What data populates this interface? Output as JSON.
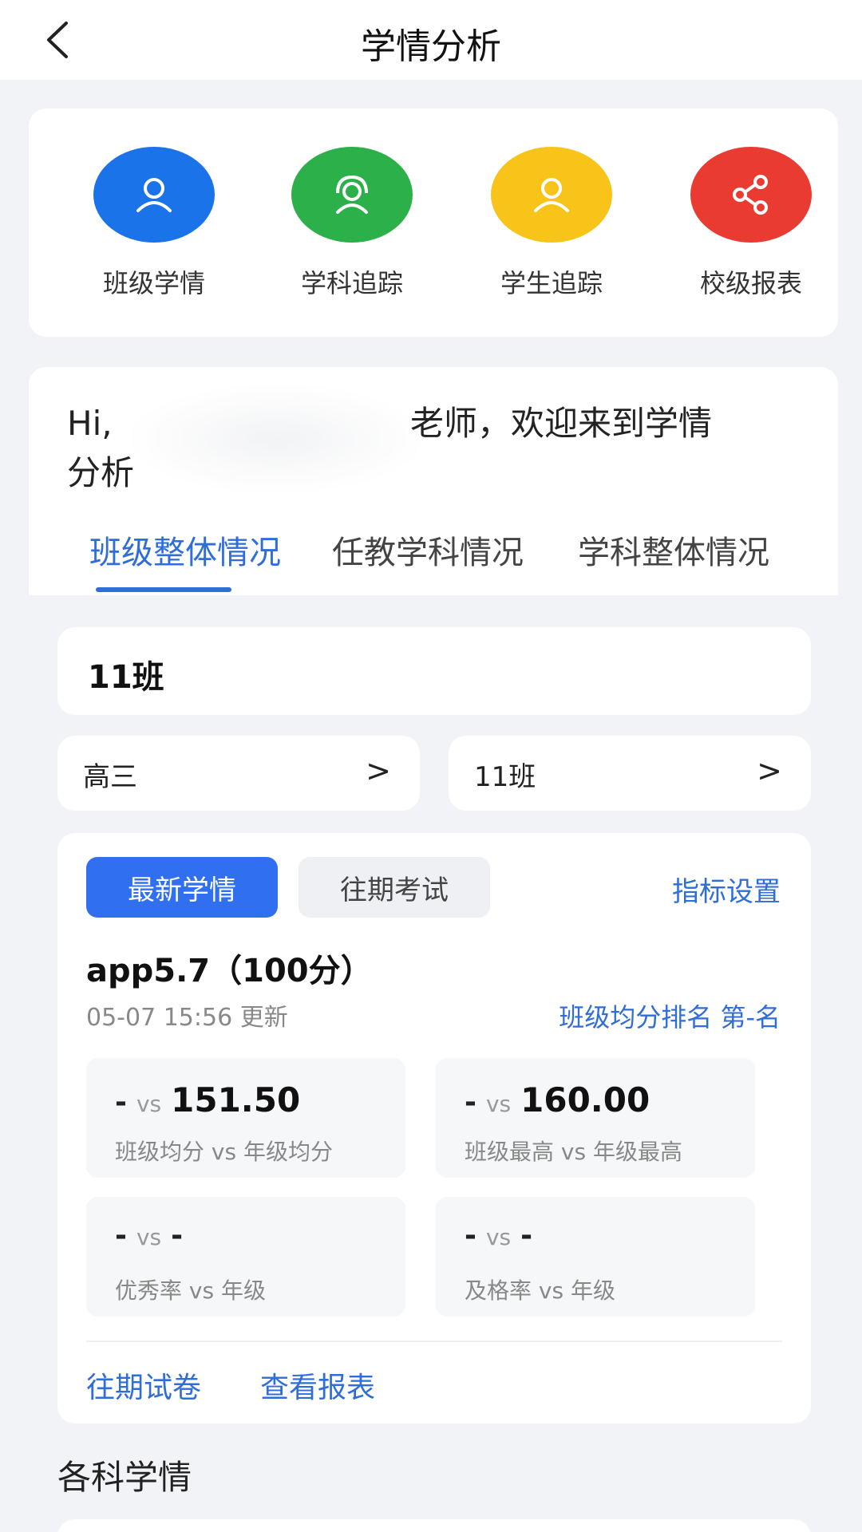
{
  "header": {
    "title": "学情分析"
  },
  "quick_actions": [
    {
      "label": "班级学情",
      "icon": "user-icon",
      "color": "#1a73e8"
    },
    {
      "label": "学科追踪",
      "icon": "headset-user-icon",
      "color": "#2bb04a"
    },
    {
      "label": "学生追踪",
      "icon": "user-icon",
      "color": "#f8c41a"
    },
    {
      "label": "校级报表",
      "icon": "share-icon",
      "color": "#ea3b32"
    }
  ],
  "welcome": {
    "hi": "Hi,",
    "line1_rest": "老师，欢迎来到学情",
    "line2": "分析"
  },
  "tabs": [
    {
      "label": "班级整体情况",
      "active": true
    },
    {
      "label": "任教学科情况",
      "active": false
    },
    {
      "label": "学科整体情况",
      "active": false
    }
  ],
  "class_card": {
    "title": "11班"
  },
  "selectors": {
    "grade": "高三",
    "class": "11班",
    "arrow": ">"
  },
  "analysis": {
    "latest_label": "最新学情",
    "past_label": "往期考试",
    "settings_label": "指标设置",
    "exam_title": "app5.7（100分）",
    "updated": "05-07 15:56 更新",
    "rank": "班级均分排名 第-名",
    "stats": [
      {
        "left": "-",
        "vs": "vs",
        "right": "151.50",
        "caption": "班级均分 vs 年级均分"
      },
      {
        "left": "-",
        "vs": "vs",
        "right": "160.00",
        "caption": "班级最高 vs 年级最高"
      },
      {
        "left": "-",
        "vs": "vs",
        "right": "-",
        "caption": "优秀率 vs 年级"
      },
      {
        "left": "-",
        "vs": "vs",
        "right": "-",
        "caption": "及格率 vs 年级"
      }
    ],
    "link_past_papers": "往期试卷",
    "link_view_report": "查看报表"
  },
  "section": {
    "title": "各科学情"
  }
}
